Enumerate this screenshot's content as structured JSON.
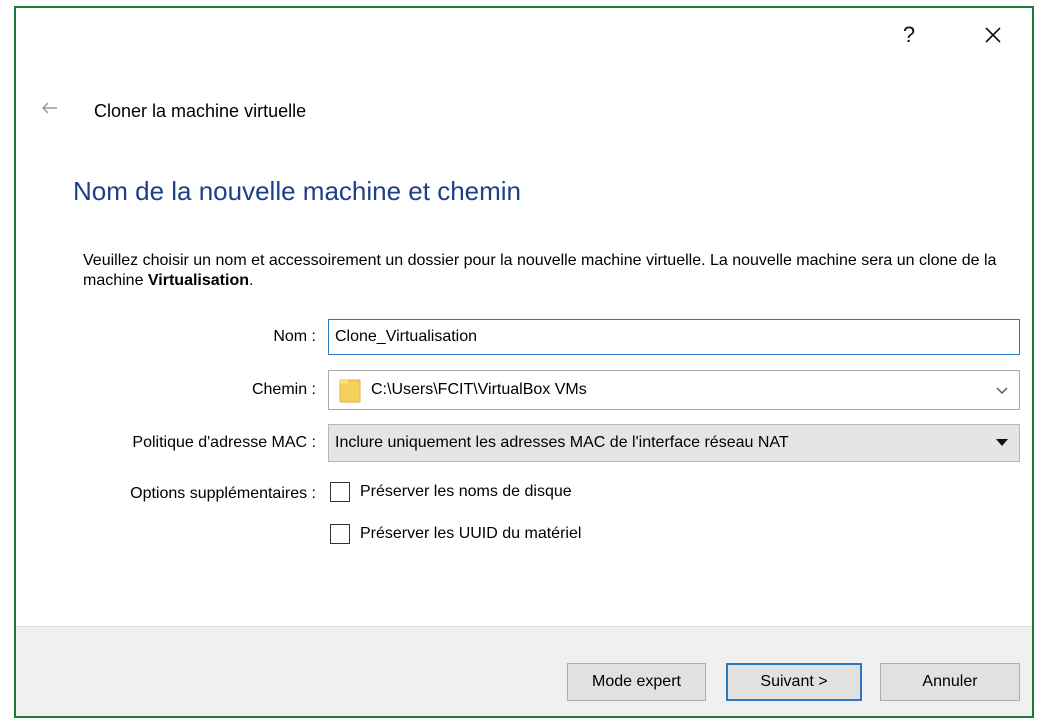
{
  "window": {
    "help_label": "?",
    "wizard_title": "Cloner la machine virtuelle"
  },
  "page": {
    "heading": "Nom de la nouvelle machine et chemin",
    "description_part1": "Veuillez choisir un nom et accessoirement un dossier pour la nouvelle machine virtuelle. La nouvelle machine sera un clone de la machine ",
    "description_bold": "Virtualisation",
    "description_end": "."
  },
  "form": {
    "name_label": "Nom :",
    "name_value": "Clone_Virtualisation",
    "path_label": "Chemin :",
    "path_value": "C:\\Users\\FCIT\\VirtualBox VMs",
    "mac_label": "Politique d'adresse MAC :",
    "mac_value": "Inclure uniquement les adresses MAC de l'interface réseau NAT",
    "options_label": "Options supplémentaires :",
    "option_disk_names": "Préserver les noms de disque",
    "option_uuid": "Préserver les UUID du matériel",
    "option_disk_names_checked": false,
    "option_uuid_checked": false
  },
  "buttons": {
    "expert": "Mode expert",
    "next": "Suivant >",
    "cancel": "Annuler"
  },
  "icons": {
    "help": "help-icon",
    "close": "close-icon",
    "back": "back-arrow-icon",
    "folder": "folder-icon",
    "dropdown": "chevron-down-icon",
    "select": "triangle-down-icon"
  },
  "colors": {
    "heading": "#1e3f8a",
    "focus_border": "#2b79c6",
    "window_border": "#1e7a3c"
  }
}
